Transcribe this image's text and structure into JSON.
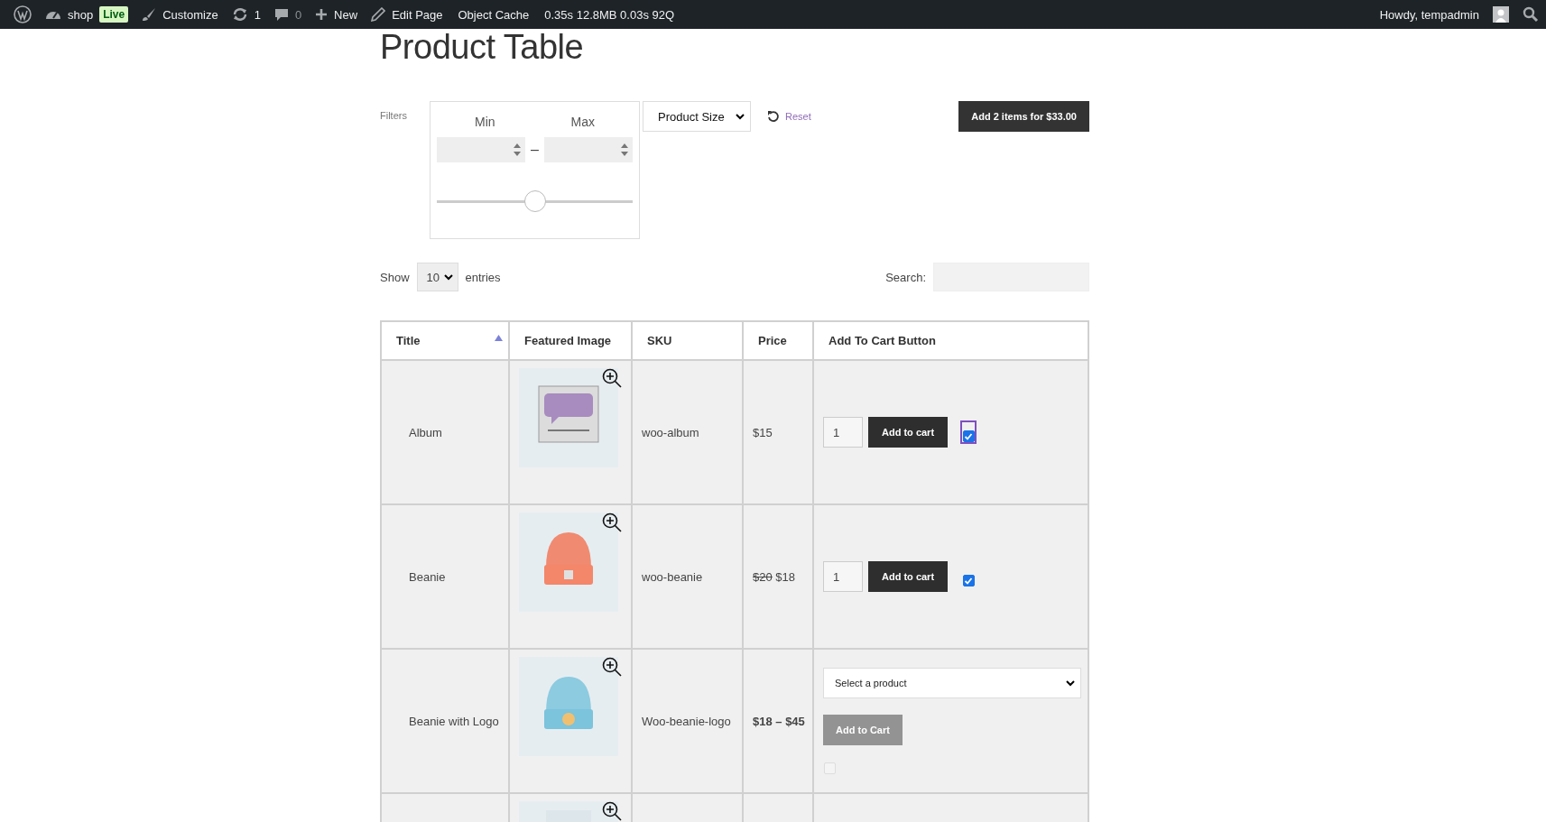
{
  "admin_bar": {
    "site": "shop",
    "live_badge": "Live",
    "customize": "Customize",
    "updates": "1",
    "comments": "0",
    "new": "New",
    "edit_page": "Edit Page",
    "object_cache": "Object Cache",
    "stats": "0.35s 12.8MB 0.03s 92Q",
    "greeting": "Howdy, tempadmin"
  },
  "page_title": "Product Table",
  "filters": {
    "label": "Filters",
    "min_label": "Min",
    "max_label": "Max",
    "separator": "–",
    "slider": {
      "level": 0.5
    },
    "size_select": "Product Size",
    "reset": "Reset"
  },
  "add_selected_button": "Add 2 items for $33.00",
  "length": {
    "show": "Show",
    "value": "10",
    "entries": "entries"
  },
  "search": {
    "label": "Search:"
  },
  "table": {
    "columns": [
      {
        "label": "Title",
        "sorted": true
      },
      {
        "label": "Featured Image",
        "sorted": false
      },
      {
        "label": "SKU",
        "sorted": false
      },
      {
        "label": "Price",
        "sorted": false
      },
      {
        "label": "Add To Cart Button",
        "sorted": false
      }
    ],
    "rows": [
      {
        "kind": "simple",
        "title": "Album",
        "sku": "woo-album",
        "price": "$15",
        "quantity": "1",
        "button": "Add to cart",
        "checked": true,
        "focused": true
      },
      {
        "kind": "simple",
        "title": "Beanie",
        "sku": "woo-beanie",
        "regular_price": "$20",
        "price": "$18",
        "quantity": "1",
        "button": "Add to cart",
        "checked": true,
        "focused": false
      },
      {
        "kind": "variable",
        "title": "Beanie with Logo",
        "sku": "Woo-beanie-logo",
        "price": "$18 – $45",
        "select": "Select a product",
        "button": "Add to Cart",
        "checked": false,
        "focused": false
      },
      {
        "kind": "partial"
      }
    ]
  }
}
